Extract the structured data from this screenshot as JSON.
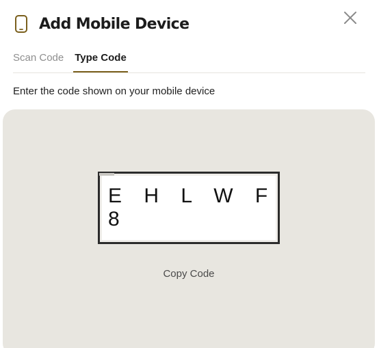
{
  "dialog": {
    "title": "Add Mobile Device",
    "icon": "mobile-phone-icon",
    "close_icon": "close-icon",
    "accent_color": "#7a5f1c"
  },
  "tabs": [
    {
      "label": "Scan Code",
      "active": false
    },
    {
      "label": "Type Code",
      "active": true
    }
  ],
  "type_code": {
    "instruction": "Enter the code shown on your mobile device",
    "code": "E H L W F 8",
    "copy_label": "Copy Code"
  }
}
